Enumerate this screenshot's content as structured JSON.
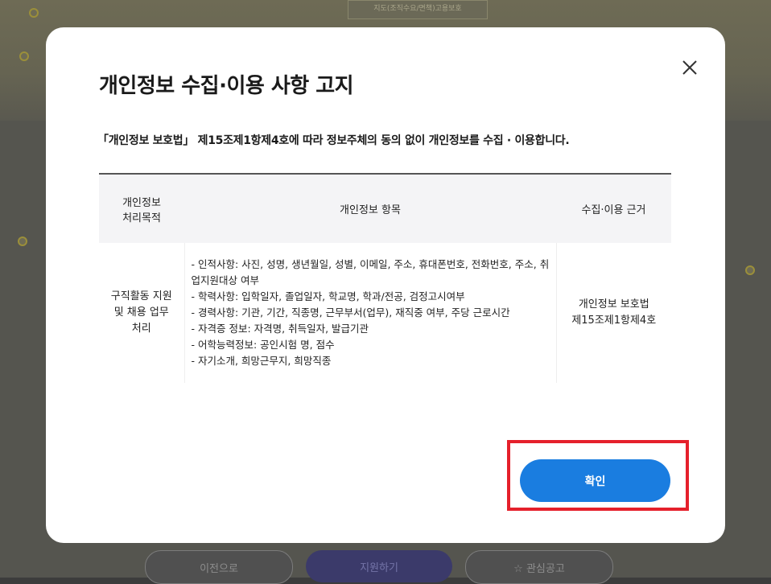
{
  "background": {
    "map_box_text": "지도(조직수요/면책)고용보호",
    "prev_button": "이전으로",
    "apply_button": "지원하기",
    "favorite_button": "☆ 관심공고"
  },
  "modal": {
    "title": "개인정보 수집·이용 사항 고지",
    "notice": "「개인정보 보호법」 제15조제1항제4호에 따라 정보주체의 동의 없이 개인정보를 수집 · 이용합니다.",
    "close_icon": "close-icon",
    "table": {
      "headers": {
        "purpose": "개인정보\n처리목적",
        "items": "개인정보 항목",
        "basis": "수집·이용 근거"
      },
      "row": {
        "purpose": "구직활동 지원\n및 채용 업무\n처리",
        "items": [
          "- 인적사항: 사진, 성명, 생년월일, 성별, 이메일, 주소, 휴대폰번호, 전화번호, 주소, 취업지원대상 여부",
          "- 학력사항: 입학일자, 졸업일자, 학교명, 학과/전공, 검정고시여부",
          "- 경력사항: 기관, 기간, 직종명, 근무부서(업무), 재직중 여부, 주당 근로시간",
          "- 자격증 정보: 자격명, 취득일자, 발급기관",
          "- 어학능력정보: 공인시험 명, 점수",
          "- 자기소개, 희망근무지, 희망직종"
        ],
        "basis": "개인정보 보호법\n제15조제1항제4호"
      }
    },
    "confirm_button": "확인"
  },
  "colors": {
    "accent": "#1a7de0",
    "highlight": "#e5202b"
  }
}
